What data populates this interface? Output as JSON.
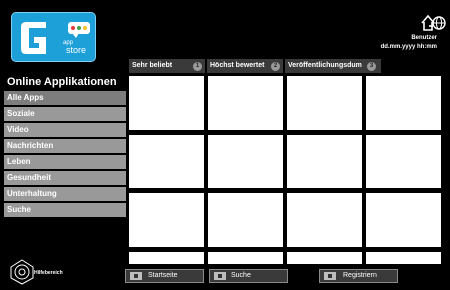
{
  "logo": {
    "app_text": "app",
    "store_text": "store"
  },
  "header": {
    "user_label": "Benutzer",
    "datetime": "dd.mm.yyyy hh:mm"
  },
  "tabs": [
    {
      "label": "Sehr beliebt",
      "num": "1"
    },
    {
      "label": "Höchst bewertet",
      "num": "2"
    },
    {
      "label": "Veröffentlichungsdum",
      "num": "3"
    }
  ],
  "sidebar": {
    "title": "Online Applikationen",
    "items": [
      {
        "label": "Alle Apps"
      },
      {
        "label": "Soziale"
      },
      {
        "label": "Video"
      },
      {
        "label": "Nachrichten"
      },
      {
        "label": "Leben"
      },
      {
        "label": "Gesundheit"
      },
      {
        "label": "Unterhaltung"
      },
      {
        "label": "Suche"
      }
    ]
  },
  "help": {
    "label": "Hilfebereich"
  },
  "footer": {
    "buttons": [
      {
        "label": "Startseite"
      },
      {
        "label": "Suche"
      },
      {
        "label": "Registriern"
      }
    ]
  },
  "colors": {
    "logo_bg": "#1d9fd8",
    "sidebar_item": "#999999",
    "tab_bg": "#3a3a3a"
  }
}
